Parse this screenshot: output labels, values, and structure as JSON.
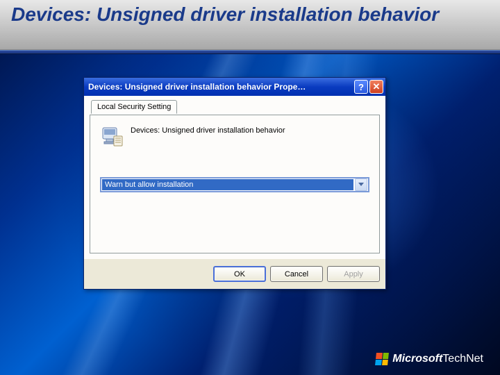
{
  "slide": {
    "title": "Devices: Unsigned driver installation behavior"
  },
  "dialog": {
    "title": "Devices: Unsigned driver installation behavior Prope…",
    "tab_label": "Local Security Setting",
    "policy_name": "Devices: Unsigned driver installation behavior",
    "selected_option": "Warn but allow installation",
    "buttons": {
      "ok": "OK",
      "cancel": "Cancel",
      "apply": "Apply"
    }
  },
  "footer": {
    "brand": "Microsoft",
    "product": "TechNet"
  }
}
